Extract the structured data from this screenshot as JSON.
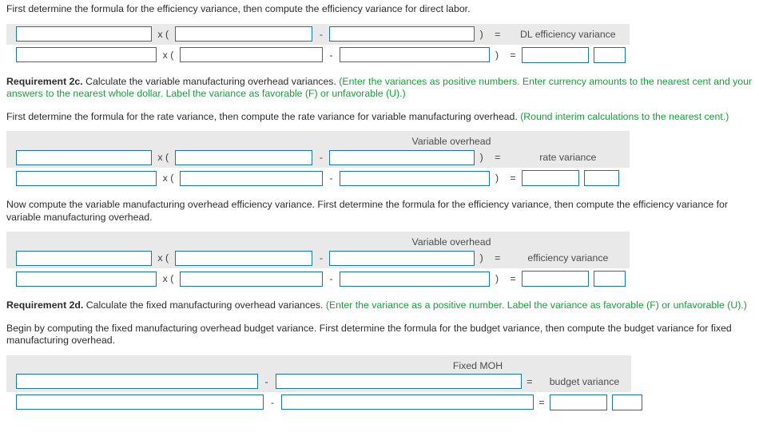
{
  "colors": {
    "input_border": "#1b7898",
    "band": "#e9e9e9",
    "green_text": "#199c3c",
    "body_text": "#2b2b2b",
    "label_text": "#4c4c4c"
  },
  "glyphs": {
    "times_open_paren": "x (",
    "minus": "-",
    "close_paren": ")",
    "equals": "="
  },
  "sections": [
    {
      "id": "dl-efficiency",
      "intro": "First determine the formula for the efficiency variance, then compute the efficiency variance for direct labor.",
      "caption_line1": "",
      "caption_line2": "DL efficiency variance",
      "layout": "standard"
    },
    {
      "id": "vmoh-rate",
      "req_label": "Requirement 2c.",
      "req_text": " Calculate the variable manufacturing overhead variances. ",
      "req_green": "(Enter the variances as positive numbers. Enter currency amounts to the nearest cent and your answers to the nearest whole dollar. Label the variance as favorable (F) or unfavorable (U).)",
      "intro": "First determine the formula for the rate variance, then compute the rate variance for variable manufacturing overhead. ",
      "intro_green": "(Round interim calculations to the nearest cent.)",
      "caption_line1": "Variable overhead",
      "caption_line2": "rate variance",
      "layout": "standard"
    },
    {
      "id": "vmoh-efficiency",
      "intro": "Now compute the variable manufacturing overhead efficiency variance. First determine the formula for the efficiency variance, then compute the efficiency variance for variable manufacturing overhead.",
      "caption_line1": "Variable overhead",
      "caption_line2": "efficiency variance",
      "layout": "standard"
    },
    {
      "id": "fmoh-budget",
      "req_label": "Requirement 2d.",
      "req_text": " Calculate the fixed manufacturing overhead variances. ",
      "req_green": "(Enter the variance as a positive number. Label the variance as favorable (F) or unfavorable (U).)",
      "intro": "Begin by computing the fixed manufacturing overhead budget variance. First determine the formula for the budget variance, then compute the budget variance for fixed manufacturing overhead.",
      "caption_line1": "Fixed MOH",
      "caption_line2": "budget variance",
      "layout": "fixed"
    }
  ]
}
